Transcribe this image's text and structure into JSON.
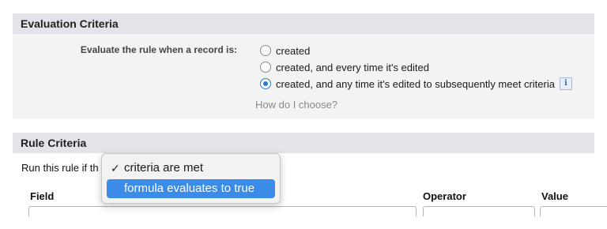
{
  "evaluation": {
    "title": "Evaluation Criteria",
    "label": "Evaluate the rule when a record is:",
    "options": [
      {
        "label": "created",
        "checked": false
      },
      {
        "label": "created, and every time it's edited",
        "checked": false
      },
      {
        "label": "created, and any time it's edited to subsequently meet criteria",
        "checked": true
      }
    ],
    "info_icon": "info-icon",
    "info_glyph": "i",
    "help_link": "How do I choose?"
  },
  "rule": {
    "title": "Rule Criteria",
    "run_prefix": "Run this rule if th",
    "dropdown": {
      "options": [
        {
          "label": "criteria are met",
          "selected": true
        },
        {
          "label": "formula evaluates to true",
          "highlighted": true
        }
      ],
      "check_glyph": "✓"
    },
    "columns": [
      "Field",
      "Operator",
      "Value"
    ]
  },
  "colors": {
    "accent": "#3b8be8",
    "radio_checked": "#2a7bd9",
    "section_header": "#e3e4ea",
    "panel": "#f3f3f3"
  }
}
